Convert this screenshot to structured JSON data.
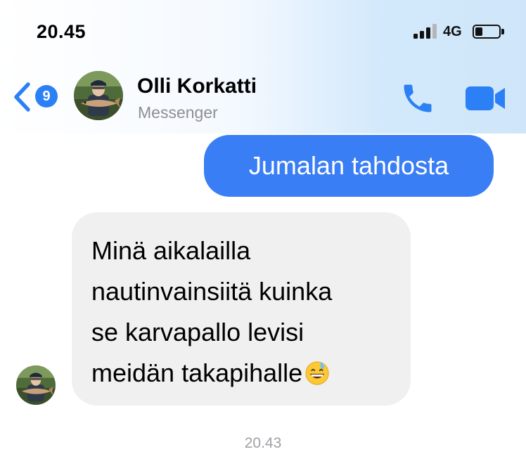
{
  "status_bar": {
    "time": "20.45",
    "network": "4G",
    "signal_bars_active": 3,
    "signal_bars_total": 4,
    "battery_level": 0.3
  },
  "header": {
    "back_badge_count": "9",
    "contact_name": "Olli Korkatti",
    "contact_subtitle": "Messenger",
    "icons": [
      "chevron-left-icon",
      "phone-icon",
      "video-camera-icon"
    ],
    "accent_color": "#2b80f5"
  },
  "messages": [
    {
      "direction": "outgoing",
      "text": "Jumalan tahdosta",
      "bubble_color": "#3a7ef5"
    },
    {
      "direction": "incoming",
      "lines": [
        "Minä aikalailla",
        "nautinvainsiitä kuinka",
        "se karvapallo levisi",
        "meidän takapihalle"
      ],
      "trailing_emoji": "grinning-face-with-sweat-icon",
      "bubble_color": "#f0f0f0"
    }
  ],
  "footer": {
    "timestamp": "20.43"
  }
}
